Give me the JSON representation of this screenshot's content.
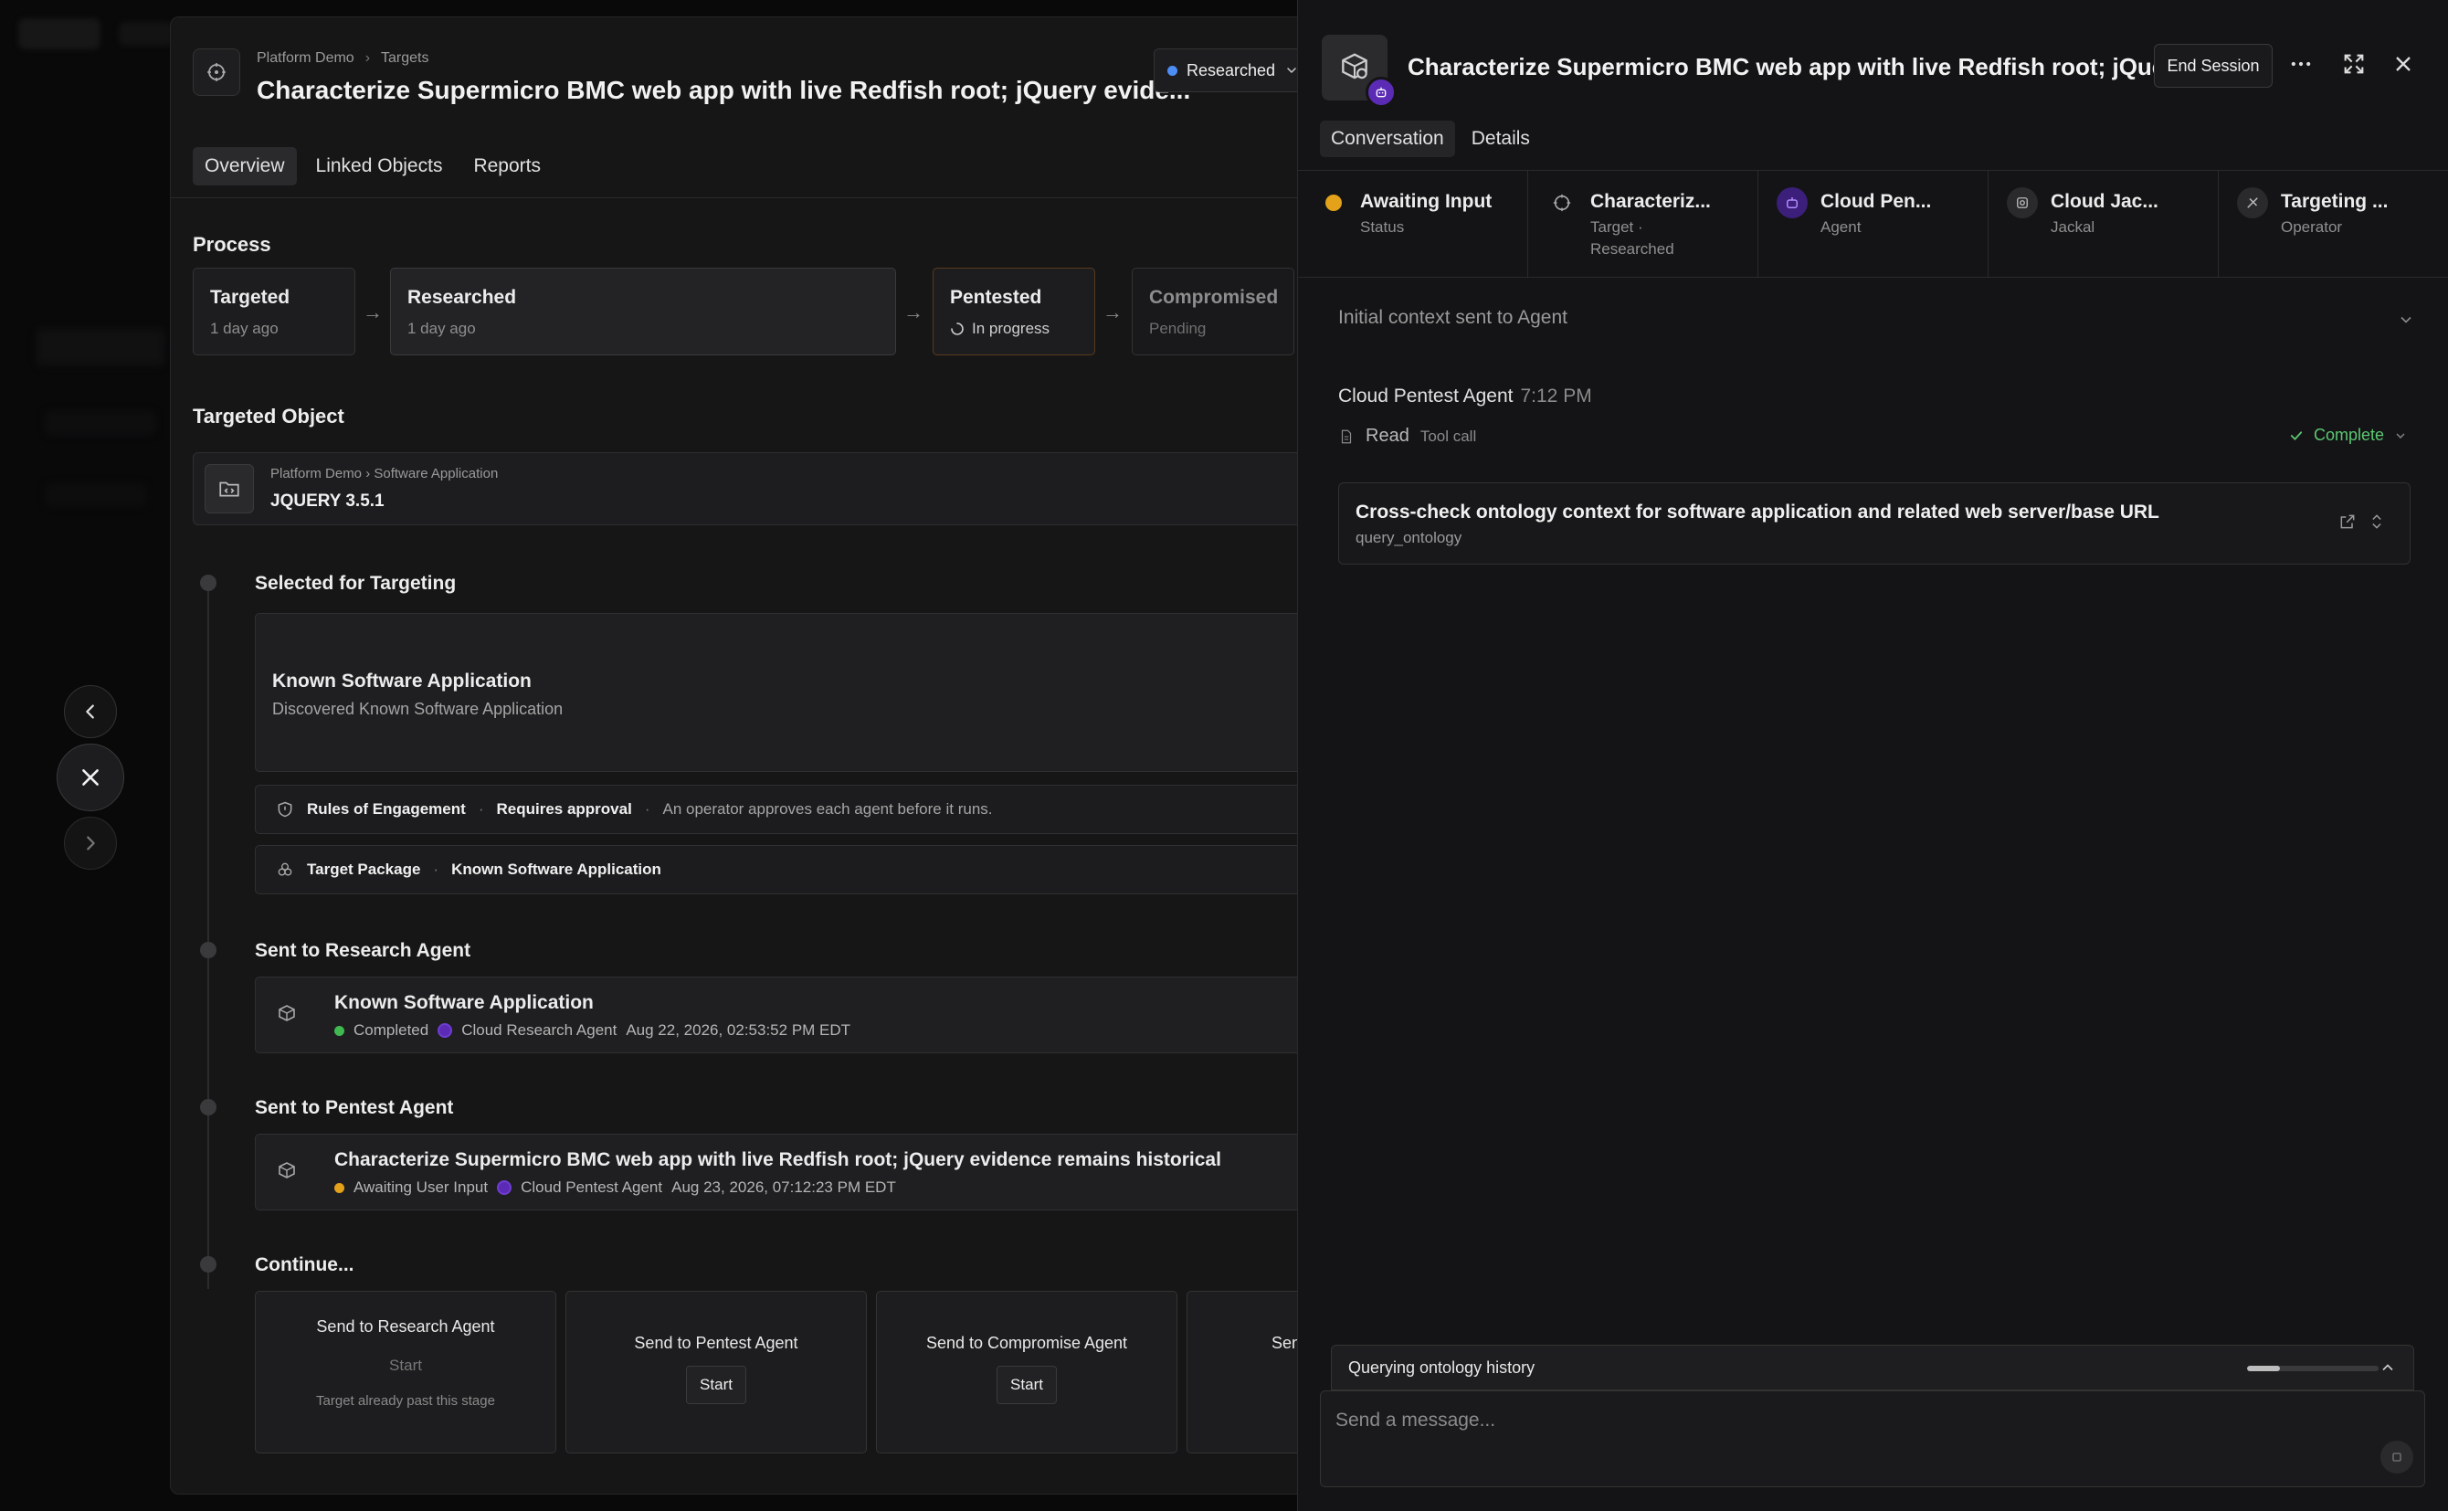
{
  "left": {
    "breadcrumb": [
      "Platform Demo",
      "Targets"
    ],
    "title": "Characterize Supermicro BMC web app with live Redfish root; jQuery evide...",
    "status": {
      "label": "Researched",
      "color": "#4c8df6"
    },
    "tabs": [
      {
        "label": "Overview"
      },
      {
        "label": "Linked Objects"
      },
      {
        "label": "Reports"
      }
    ],
    "process": {
      "heading": "Process",
      "stages": [
        {
          "title": "Targeted",
          "sub": "1 day ago"
        },
        {
          "title": "Researched",
          "sub": "1 day ago"
        },
        {
          "title": "Pentested",
          "sub": "In progress"
        },
        {
          "title": "Compromised",
          "sub": "Pending"
        }
      ]
    },
    "targeted_object": {
      "heading": "Targeted Object",
      "crumb": [
        "Platform Demo",
        "Software Application"
      ],
      "name": "JQUERY 3.5.1"
    },
    "timeline": {
      "selected": {
        "heading": "Selected for Targeting",
        "card_title": "Known Software Application",
        "card_sub": "Discovered Known Software Application",
        "roe_label": "Rules of Engagement",
        "roe_value": "Requires approval",
        "roe_desc": "An operator approves each agent before it runs.",
        "pkg_label": "Target Package",
        "pkg_value": "Known Software Application"
      },
      "research": {
        "heading": "Sent to Research Agent",
        "title": "Known Software Application",
        "status": "Completed",
        "status_color": "#3fb950",
        "agent": "Cloud Research Agent",
        "time": "Aug 22, 2026, 02:53:52 PM EDT"
      },
      "pentest": {
        "heading": "Sent to Pentest Agent",
        "title": "Characterize Supermicro BMC web app with live Redfish root; jQuery evidence remains historical",
        "status": "Awaiting User Input",
        "status_color": "#e3a21a",
        "agent": "Cloud Pentest Agent",
        "time": "Aug 23, 2026, 07:12:23 PM EDT"
      },
      "continue": {
        "heading": "Continue...",
        "cards": [
          {
            "title": "Send to Research Agent",
            "button": "Start",
            "note": "Target already past this stage"
          },
          {
            "title": "Send to Pentest Agent",
            "button": "Start"
          },
          {
            "title": "Send to Compromise Agent",
            "button": "Start"
          },
          {
            "title": "Sen"
          }
        ]
      }
    }
  },
  "right": {
    "title": "Characterize Supermicro BMC web app with live Redfish root; jQuer...",
    "end_session": "End Session",
    "tabs": [
      {
        "label": "Conversation"
      },
      {
        "label": "Details"
      }
    ],
    "info": [
      {
        "a": "Awaiting Input",
        "b": "Status",
        "icon": "status-dot-icon",
        "color": "#e3a21a"
      },
      {
        "a": "Characteriz...",
        "b": "Target ·",
        "b2": "Researched",
        "icon": "target-icon"
      },
      {
        "a": "Cloud Pen...",
        "b": "Agent",
        "icon": "robot-icon"
      },
      {
        "a": "Cloud Jac...",
        "b": "Jackal",
        "icon": "jackal-icon"
      },
      {
        "a": "Targeting ...",
        "b": "Operator",
        "icon": "operator-icon"
      }
    ],
    "context_label": "Initial context sent to Agent",
    "message": {
      "sender": "Cloud Pentest Agent",
      "time": "7:12 PM",
      "tool": "Read",
      "tool_type": "Tool call",
      "status": "Complete",
      "query_title": "Cross-check ontology context for software application and related web server/base URL",
      "query_fn": "query_ontology"
    },
    "querying": {
      "label": "Querying ontology history",
      "progress": 0.25
    },
    "input_placeholder": "Send a message..."
  }
}
